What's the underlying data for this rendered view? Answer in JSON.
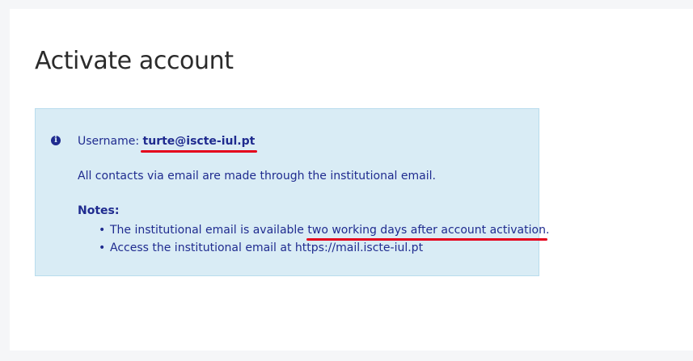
{
  "page": {
    "title": "Activate account"
  },
  "info": {
    "icon": "info-circle-icon",
    "username_label": "Username:",
    "username_value": "turte@iscte-iul.pt",
    "contacts_text": "All contacts via email are made through the institutional email.",
    "notes_title": "Notes:",
    "note1_prefix": "The institutional email is available",
    "note1_highlight": "two working days after account activation",
    "note1_suffix": ".",
    "note2": "Access the institutional email at https://mail.iscte-iul.pt",
    "bullet": "•"
  },
  "colors": {
    "info_bg": "#d9ecf5",
    "info_text": "#1f2b8f",
    "highlight_underline": "#e4001b"
  }
}
